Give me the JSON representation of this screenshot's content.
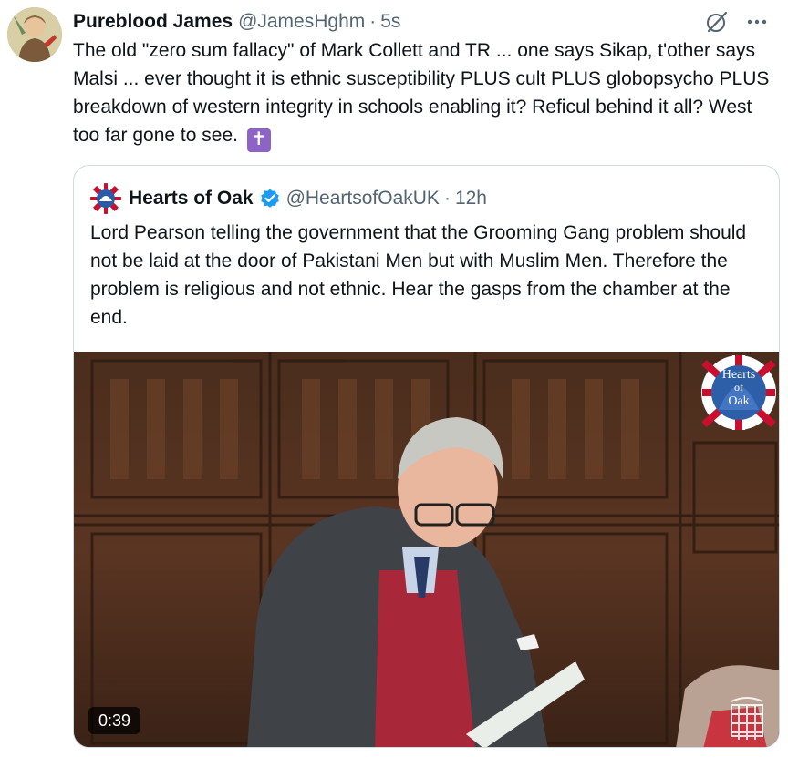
{
  "tweet": {
    "display_name": "Pureblood James",
    "handle": "@JamesHghm",
    "separator": "·",
    "time": "5s",
    "text": "The old \"zero sum fallacy\" of Mark Collett and TR ... one says Sikap, t'other says Malsi ... ever thought it is ethnic susceptibility PLUS cult PLUS globopsycho PLUS breakdown of western integrity in schools enabling it? Reficul behind it all? West too far gone to see.",
    "emoji": "✝",
    "more_label": "···"
  },
  "quote": {
    "display_name": "Hearts of Oak",
    "handle": "@HeartsofOakUK",
    "separator": "·",
    "time": "12h",
    "text": "Lord Pearson telling the government that the Grooming Gang problem should not be laid at the door of Pakistani Men but with Muslim Men. Therefore the problem is religious and not ethnic. Hear the gasps from the chamber at the end.",
    "video": {
      "duration": "0:39",
      "watermark_lines": [
        "Hearts",
        "of",
        "Oak"
      ]
    }
  },
  "colors": {
    "text": "#0f1419",
    "secondary": "#536471",
    "verified": "#1d9bf0",
    "border": "#cfd9de",
    "emoji_bg": "#8e63c7"
  },
  "icons": {
    "grok": "grok-icon",
    "more": "more-icon",
    "verified": "verified-badge-icon"
  }
}
